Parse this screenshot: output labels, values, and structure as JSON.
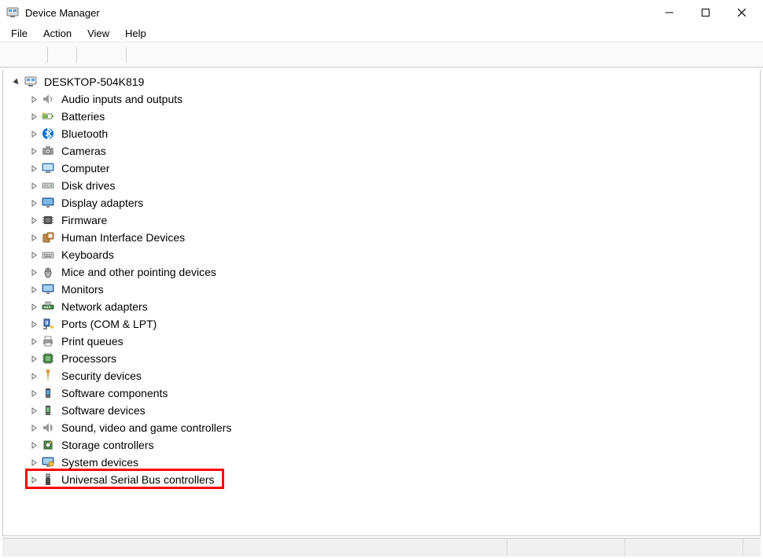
{
  "window": {
    "title": "Device Manager"
  },
  "menu": {
    "items": [
      "File",
      "Action",
      "View",
      "Help"
    ]
  },
  "toolbar": {
    "buttons": [
      {
        "name": "back-button",
        "icon": "arrow-left-icon"
      },
      {
        "name": "forward-button",
        "icon": "arrow-right-icon"
      },
      {
        "name": "show-hide-tree-button",
        "icon": "panel-icon"
      },
      {
        "name": "help-button",
        "icon": "help-icon"
      },
      {
        "name": "action-list-button",
        "icon": "list-icon"
      },
      {
        "name": "scan-hardware-button",
        "icon": "monitor-scan-icon"
      }
    ]
  },
  "tree": {
    "root": {
      "label": "DESKTOP-504K819",
      "expanded": true,
      "icon": "computer-root-icon"
    },
    "children": [
      {
        "label": "Audio inputs and outputs",
        "icon": "audio-icon"
      },
      {
        "label": "Batteries",
        "icon": "battery-icon"
      },
      {
        "label": "Bluetooth",
        "icon": "bluetooth-icon"
      },
      {
        "label": "Cameras",
        "icon": "camera-icon"
      },
      {
        "label": "Computer",
        "icon": "computer-icon"
      },
      {
        "label": "Disk drives",
        "icon": "disk-icon"
      },
      {
        "label": "Display adapters",
        "icon": "display-icon"
      },
      {
        "label": "Firmware",
        "icon": "firmware-icon"
      },
      {
        "label": "Human Interface Devices",
        "icon": "hid-icon"
      },
      {
        "label": "Keyboards",
        "icon": "keyboard-icon"
      },
      {
        "label": "Mice and other pointing devices",
        "icon": "mouse-icon"
      },
      {
        "label": "Monitors",
        "icon": "monitor-icon"
      },
      {
        "label": "Network adapters",
        "icon": "network-icon"
      },
      {
        "label": "Ports (COM & LPT)",
        "icon": "port-icon"
      },
      {
        "label": "Print queues",
        "icon": "printer-icon"
      },
      {
        "label": "Processors",
        "icon": "cpu-icon"
      },
      {
        "label": "Security devices",
        "icon": "security-icon"
      },
      {
        "label": "Software components",
        "icon": "software-component-icon"
      },
      {
        "label": "Software devices",
        "icon": "software-device-icon"
      },
      {
        "label": "Sound, video and game controllers",
        "icon": "sound-icon"
      },
      {
        "label": "Storage controllers",
        "icon": "storage-icon"
      },
      {
        "label": "System devices",
        "icon": "system-icon"
      },
      {
        "label": "Universal Serial Bus controllers",
        "icon": "usb-icon",
        "highlighted": true
      }
    ]
  }
}
